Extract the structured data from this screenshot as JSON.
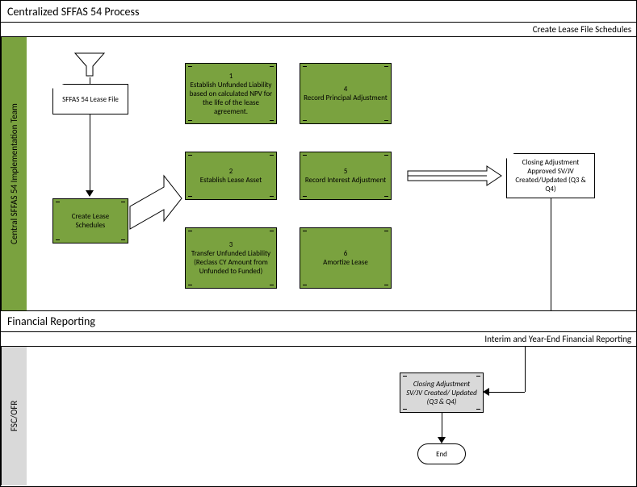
{
  "title": "Centralized SFFAS 54 Process",
  "upper_band_label": "Create Lease File Schedules",
  "swimlane1_label": "Central SFFAS 54 Implementation Team",
  "lease_file_tag": "SFFAS 54 Lease File",
  "create_lease_schedules": "Create Lease Schedules",
  "step1_num": "1",
  "step1_text": "Establish Unfunded Liability based on calculated NPV for the life of the lease agreement.",
  "step2_num": "2",
  "step2_text": "Establish Lease Asset",
  "step3_num": "3",
  "step3_text": "Transfer Unfunded Liability (Reclass CY Amount from Unfunded to Funded)",
  "step4_num": "4",
  "step4_text": "Record Principal Adjustment",
  "step5_num": "5",
  "step5_text": "Record Interest Adjustment",
  "step6_num": "6",
  "step6_text": "Amortize Lease",
  "closing_adj_note": "Closing Adjustment Approved SV/JV Created/Updated (Q3 & Q4)",
  "section2_title": "Financial Reporting",
  "lower_band_label": "Interim and Year-End Financial Reporting",
  "swimlane2_label": "FSC/OFR",
  "closing_adj_box": "Closing Adjustment SV/JV Created/ Updated (Q3 & Q4)",
  "end_label": "End"
}
